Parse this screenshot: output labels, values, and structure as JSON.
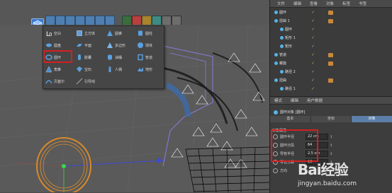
{
  "toolbar": {
    "active_tool_icon": "cube-icon"
  },
  "primitive_panel": {
    "items": [
      {
        "label": "空白",
        "icon": "null-icon"
      },
      {
        "label": "立方体",
        "icon": "cube-icon"
      },
      {
        "label": "圆锥",
        "icon": "cone-icon"
      },
      {
        "label": "圆柱",
        "icon": "cylinder-icon"
      },
      {
        "label": "圆盘",
        "icon": "disc-icon"
      },
      {
        "label": "平面",
        "icon": "plane-icon"
      },
      {
        "label": "多边形",
        "icon": "polygon-icon"
      },
      {
        "label": "球体",
        "icon": "sphere-icon"
      },
      {
        "label": "圆环",
        "icon": "torus-icon"
      },
      {
        "label": "胶囊",
        "icon": "capsule-icon"
      },
      {
        "label": "油桶",
        "icon": "oiltank-icon"
      },
      {
        "label": "管道",
        "icon": "tube-icon"
      },
      {
        "label": "角锥",
        "icon": "pyramid-icon"
      },
      {
        "label": "宝石",
        "icon": "gem-icon"
      },
      {
        "label": "人偶",
        "icon": "figure-icon"
      },
      {
        "label": "地形",
        "icon": "landscape-icon"
      },
      {
        "label": "贝塞尔",
        "icon": "bezier-icon"
      },
      {
        "label": "引导线",
        "icon": "guide-icon"
      }
    ]
  },
  "object_manager": {
    "menu": [
      "文件",
      "编辑",
      "查看",
      "对象",
      "标签",
      "书签"
    ],
    "rows": [
      {
        "name": "圆环",
        "indent": 0
      },
      {
        "name": "扭曲 1",
        "indent": 0
      },
      {
        "name": "圆环",
        "indent": 1
      },
      {
        "name": "矩形 1",
        "indent": 1
      },
      {
        "name": "矩形",
        "indent": 1
      },
      {
        "name": "管道",
        "indent": 0
      },
      {
        "name": "螺旋",
        "indent": 0
      },
      {
        "name": "路径 2",
        "indent": 1
      },
      {
        "name": "扭曲",
        "indent": 0
      },
      {
        "name": "路径 1",
        "indent": 1
      }
    ]
  },
  "attribute_manager": {
    "menu": [
      "模式",
      "编辑",
      "用户数据"
    ],
    "object_title": "圆环对象 [圆环]",
    "tabs": [
      "基本",
      "坐标",
      "对象"
    ],
    "active_tab": "对象",
    "section": "对象属性",
    "props": [
      {
        "label": "圆环半径",
        "value": "22 cm"
      },
      {
        "label": "圆环分段",
        "value": "64"
      },
      {
        "label": "导管半径",
        "value": "2.5 cm"
      },
      {
        "label": "导管分段",
        "value": "18"
      },
      {
        "label": "方向",
        "value": ""
      }
    ]
  },
  "watermark": {
    "main": "Bai经验",
    "sub": "jingyan.baidu.com"
  },
  "colors": {
    "accent": "#5b7fa8",
    "highlight": "#d42020",
    "torus": "#d98a2b"
  }
}
